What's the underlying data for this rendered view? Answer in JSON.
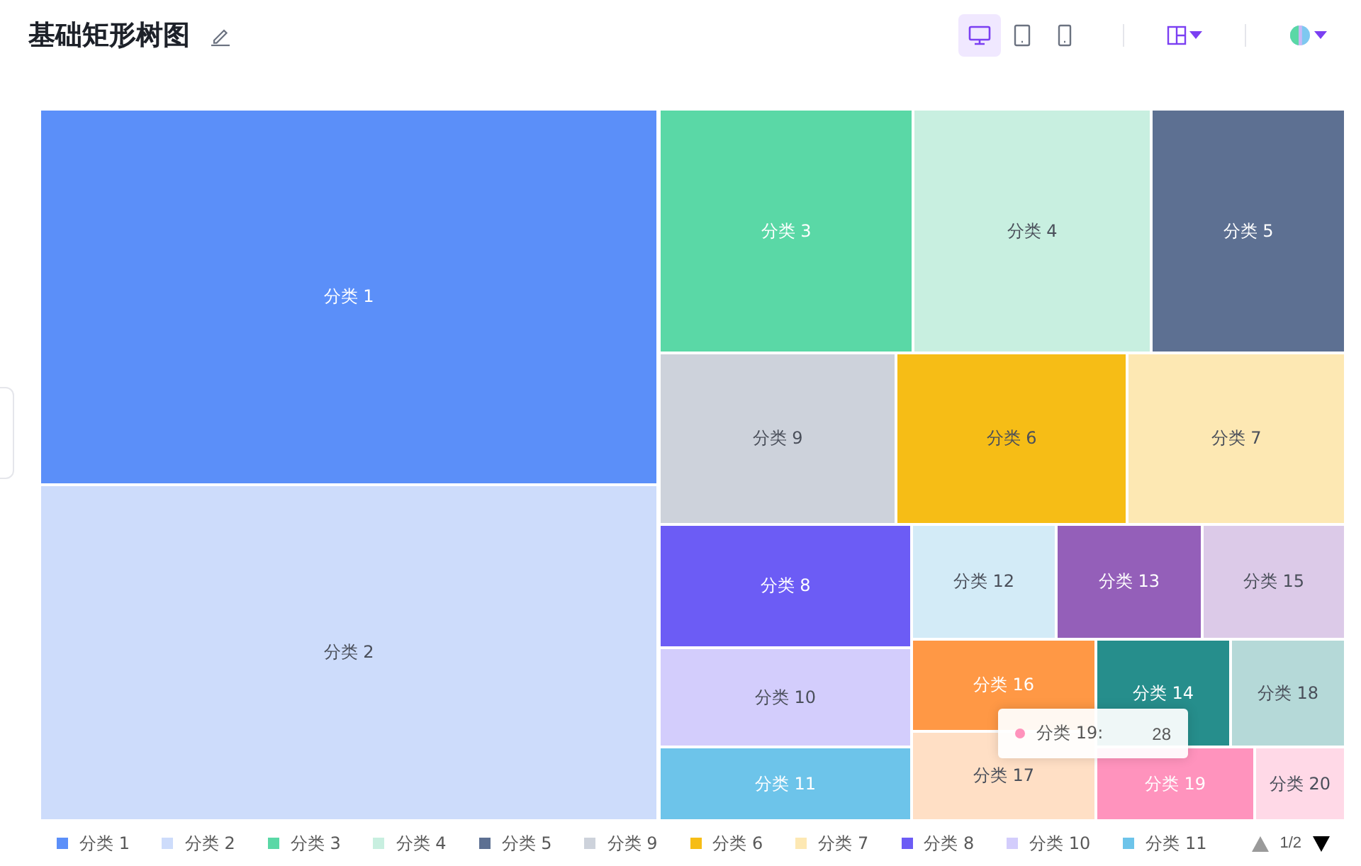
{
  "title": "基础矩形树图",
  "devices": [
    {
      "kind": "desktop",
      "selected": true
    },
    {
      "kind": "tablet",
      "selected": false
    },
    {
      "kind": "phone",
      "selected": false
    }
  ],
  "treemap": {
    "cells": [
      {
        "label": "分类 1",
        "color": "#5b8ff9"
      },
      {
        "label": "分类 2",
        "color": "#cddcfb"
      },
      {
        "label": "分类 3",
        "color": "#5ad8a6"
      },
      {
        "label": "分类 4",
        "color": "#c8efe0"
      },
      {
        "label": "分类 5",
        "color": "#5d7092"
      },
      {
        "label": "分类 9",
        "color": "#cdd2db"
      },
      {
        "label": "分类 6",
        "color": "#f6bd16"
      },
      {
        "label": "分类 7",
        "color": "#fde8b3"
      },
      {
        "label": "分类 8",
        "color": "#6c5cf5"
      },
      {
        "label": "分类 12",
        "color": "#d3ebf7"
      },
      {
        "label": "分类 13",
        "color": "#945fb9"
      },
      {
        "label": "分类 15",
        "color": "#dccae8"
      },
      {
        "label": "分类 10",
        "color": "#d3cdfc"
      },
      {
        "label": "分类 11",
        "color": "#6dc4ea"
      },
      {
        "label": "分类 16",
        "color": "#ff9845"
      },
      {
        "label": "分类 14",
        "color": "#268e8c"
      },
      {
        "label": "分类 18",
        "color": "#b5d9d8"
      },
      {
        "label": "分类 17",
        "color": "#ffdfc5"
      },
      {
        "label": "分类 19",
        "color": "#ff93bd"
      },
      {
        "label": "分类 20",
        "color": "#ffd9e7"
      }
    ]
  },
  "tooltip": {
    "label": "分类 19:",
    "value": "28",
    "color": "#ff93bd"
  },
  "legend": {
    "items": [
      {
        "label": "分类 1",
        "color": "#5b8ff9"
      },
      {
        "label": "分类 2",
        "color": "#cddcfb"
      },
      {
        "label": "分类 3",
        "color": "#5ad8a6"
      },
      {
        "label": "分类 4",
        "color": "#c8efe0"
      },
      {
        "label": "分类 5",
        "color": "#5d7092"
      },
      {
        "label": "分类 9",
        "color": "#cdd2db"
      },
      {
        "label": "分类 6",
        "color": "#f6bd16"
      },
      {
        "label": "分类 7",
        "color": "#fde8b3"
      },
      {
        "label": "分类 8",
        "color": "#6c5cf5"
      },
      {
        "label": "分类 10",
        "color": "#d3cdfc"
      },
      {
        "label": "分类 11",
        "color": "#6dc4ea"
      }
    ],
    "page": "1/2",
    "prev_disabled": true
  }
}
